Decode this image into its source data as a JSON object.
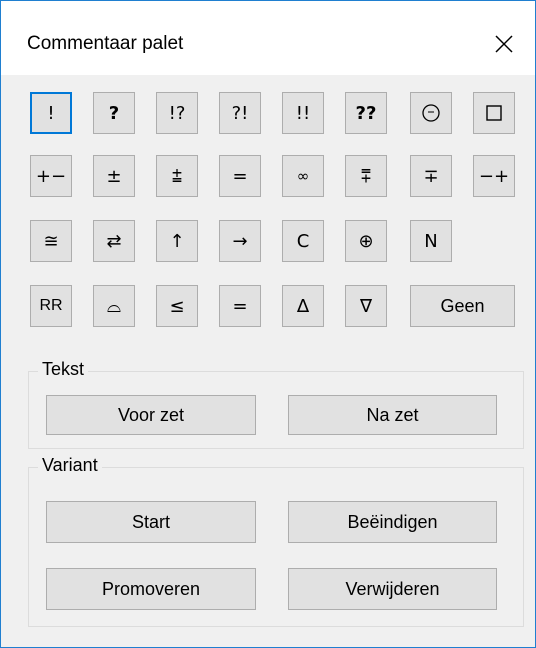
{
  "window": {
    "title": "Commentaar palet",
    "close_icon": "close-icon"
  },
  "symbols": {
    "row1": [
      "!",
      "?",
      "!?",
      "?!",
      "!!",
      "??",
      "◯",
      "□"
    ],
    "row2": [
      "+−",
      "±",
      "⩲",
      "=",
      "∞",
      "⩱",
      "∓",
      "−+"
    ],
    "row3": [
      "≅",
      "⇄",
      "↑",
      "→",
      "C",
      "⊕",
      "N"
    ],
    "row4": [
      "RR",
      "⌓",
      "≤",
      "=",
      "∆",
      "∇",
      "Geen"
    ]
  },
  "tekst": {
    "label": "Tekst",
    "before_label": "Voor zet",
    "after_label": "Na zet"
  },
  "variant": {
    "label": "Variant",
    "start_label": "Start",
    "end_label": "Beëindigen",
    "promote_label": "Promoveren",
    "delete_label": "Verwijderen"
  },
  "colors": {
    "accent": "#0078d7",
    "window_border": "#1f7fd0",
    "button_bg": "#e1e1e1",
    "panel_bg": "#f0f0f0"
  }
}
